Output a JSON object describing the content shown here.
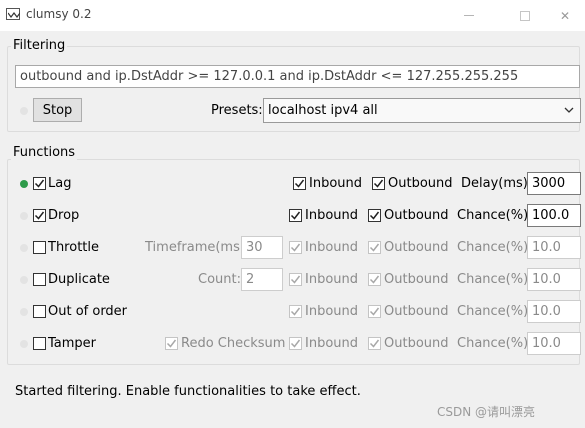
{
  "window": {
    "title": "clumsy 0.2",
    "minimize_icon": "minimize-icon",
    "maximize_icon": "maximize-icon",
    "close_icon": "close-icon",
    "close_glyph": "✕"
  },
  "filtering": {
    "group_title": "Filtering",
    "filter_text": "outbound and ip.DstAddr >= 127.0.0.1 and ip.DstAddr <= 127.255.255.255",
    "stop_label": "Stop",
    "presets_label": "Presets:",
    "preset_value": "localhost ipv4 all"
  },
  "functions": {
    "group_title": "Functions",
    "inbound_label": "Inbound",
    "outbound_label": "Outbound",
    "rows": [
      {
        "name": "Lag",
        "enabled": true,
        "active": true,
        "param_label": "Delay(ms):",
        "param_value": "3000",
        "inbound": true,
        "outbound": true
      },
      {
        "name": "Drop",
        "enabled": true,
        "active": false,
        "param_label": "Chance(%):",
        "param_value": "100.0",
        "inbound": true,
        "outbound": true
      },
      {
        "name": "Throttle",
        "enabled": false,
        "extra_label": "Timeframe(ms):",
        "extra_value": "30",
        "param_label": "Chance(%):",
        "param_value": "10.0",
        "inbound": true,
        "outbound": true
      },
      {
        "name": "Duplicate",
        "enabled": false,
        "extra_label": "Count:",
        "extra_value": "2",
        "param_label": "Chance(%):",
        "param_value": "10.0",
        "inbound": true,
        "outbound": true
      },
      {
        "name": "Out of order",
        "enabled": false,
        "param_label": "Chance(%):",
        "param_value": "10.0",
        "inbound": true,
        "outbound": true
      },
      {
        "name": "Tamper",
        "enabled": false,
        "extra_check_label": "Redo Checksum",
        "param_label": "Chance(%):",
        "param_value": "10.0",
        "inbound": true,
        "outbound": true
      }
    ]
  },
  "status": {
    "text": "Started filtering. Enable functionalities to take effect."
  },
  "watermark": "CSDN @请叫漂亮",
  "colors": {
    "active_dot": "#2e9b4a",
    "inactive_dot": "#e3e3e3",
    "disabled_text": "#8a8a8a"
  }
}
